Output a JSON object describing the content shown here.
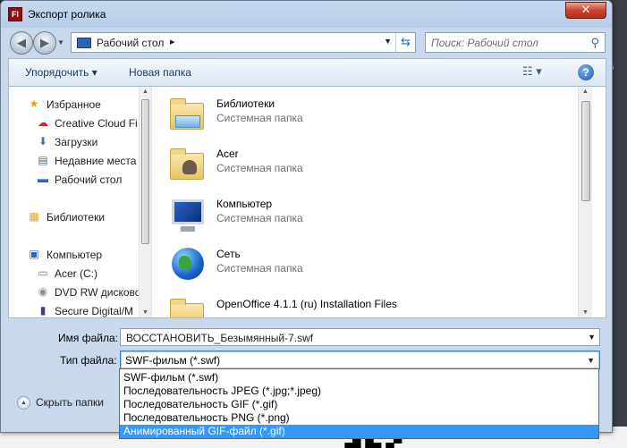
{
  "window": {
    "title": "Экспорт ролика",
    "app_icon_text": "Fl",
    "close_glyph": "✕"
  },
  "address": {
    "location": "Рабочий стол",
    "search_placeholder": "Поиск: Рабочий стол"
  },
  "toolbar": {
    "organize_label": "Упорядочить ▾",
    "new_folder_label": "Новая папка",
    "help_glyph": "?"
  },
  "nav_pane": {
    "items": [
      {
        "label": "Избранное",
        "icon": "star-icon"
      },
      {
        "label": "Creative Cloud Fi",
        "icon": "creative-cloud-icon"
      },
      {
        "label": "Загрузки",
        "icon": "downloads-icon"
      },
      {
        "label": "Недавние места",
        "icon": "recent-places-icon"
      },
      {
        "label": "Рабочий стол",
        "icon": "desktop-icon"
      },
      {
        "label": "Библиотеки",
        "icon": "libraries-icon"
      },
      {
        "label": "Компьютер",
        "icon": "computer-icon"
      },
      {
        "label": "Acer (C:)",
        "icon": "drive-icon"
      },
      {
        "label": "DVD RW дисково",
        "icon": "dvd-drive-icon"
      },
      {
        "label": "Secure Digital/M",
        "icon": "sd-card-icon"
      }
    ]
  },
  "files": [
    {
      "name": "Библиотеки",
      "type": "Системная папка",
      "icon": "libraries-folder-icon"
    },
    {
      "name": "Acer",
      "type": "Системная папка",
      "icon": "user-folder-icon"
    },
    {
      "name": "Компьютер",
      "type": "Системная папка",
      "icon": "computer-icon"
    },
    {
      "name": "Сеть",
      "type": "Системная папка",
      "icon": "network-globe-icon"
    },
    {
      "name": "OpenOffice 4.1.1 (ru) Installation Files",
      "type": "",
      "icon": "folder-icon"
    }
  ],
  "form": {
    "filename_label": "Имя файла:",
    "filename_value": "ВОССТАНОВИТЬ_Безымянный-7.swf",
    "filetype_label": "Тип файла:",
    "filetype_value": "SWF-фильм (*.swf)",
    "filetype_options": [
      "SWF-фильм (*.swf)",
      "Последовательность JPEG (*.jpg;*.jpeg)",
      "Последовательность GIF (*.gif)",
      "Последовательность PNG (*.png)",
      "Анимированный GIF-файл (*.gif)"
    ],
    "highlighted_option": "Анимированный GIF-файл (*.gif)",
    "hide_folders_label": "Скрыть папки"
  },
  "colors": {
    "selection": "#3399ff",
    "title_bg": "#c6d8ee",
    "close_red": "#c8452e"
  }
}
